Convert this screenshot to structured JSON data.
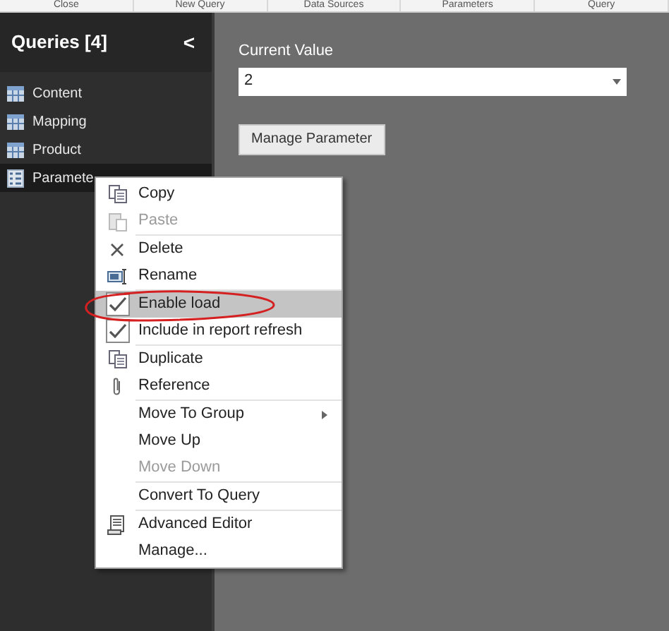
{
  "ribbon": {
    "labels": [
      "Close",
      "New Query",
      "Data Sources",
      "Parameters",
      "Query"
    ]
  },
  "sidebar": {
    "title": "Queries [4]",
    "collapse": "<",
    "items": [
      {
        "label": "Content",
        "kind": "table",
        "selected": false
      },
      {
        "label": "Mapping",
        "kind": "table",
        "selected": false
      },
      {
        "label": "Product",
        "kind": "table",
        "selected": false
      },
      {
        "label": "Paramete",
        "kind": "parameter",
        "selected": true
      }
    ]
  },
  "editor": {
    "label": "Current Value",
    "value": "2",
    "button": "Manage Parameter"
  },
  "menu": {
    "groups": [
      [
        {
          "label": "Copy",
          "kind": "copy",
          "disabled": false
        },
        {
          "label": "Paste",
          "kind": "paste",
          "disabled": true
        }
      ],
      [
        {
          "label": "Delete",
          "kind": "delete",
          "disabled": false
        },
        {
          "label": "Rename",
          "kind": "rename",
          "disabled": false
        }
      ],
      [
        {
          "label": "Enable load",
          "kind": "check",
          "checked": true,
          "selected": true,
          "disabled": false
        },
        {
          "label": "Include in report refresh",
          "kind": "check",
          "checked": true,
          "selected": false,
          "disabled": false
        }
      ],
      [
        {
          "label": "Duplicate",
          "kind": "copy",
          "disabled": false
        },
        {
          "label": "Reference",
          "kind": "reference",
          "disabled": false
        }
      ],
      [
        {
          "label": "Move To Group",
          "kind": "submenu",
          "disabled": false
        },
        {
          "label": "Move Up",
          "kind": "plain",
          "disabled": false
        },
        {
          "label": "Move Down",
          "kind": "plain",
          "disabled": true
        }
      ],
      [
        {
          "label": "Convert To Query",
          "kind": "plain",
          "disabled": false
        }
      ],
      [
        {
          "label": "Advanced Editor",
          "kind": "editor",
          "disabled": false
        },
        {
          "label": "Manage...",
          "kind": "plain",
          "disabled": false
        }
      ]
    ]
  }
}
